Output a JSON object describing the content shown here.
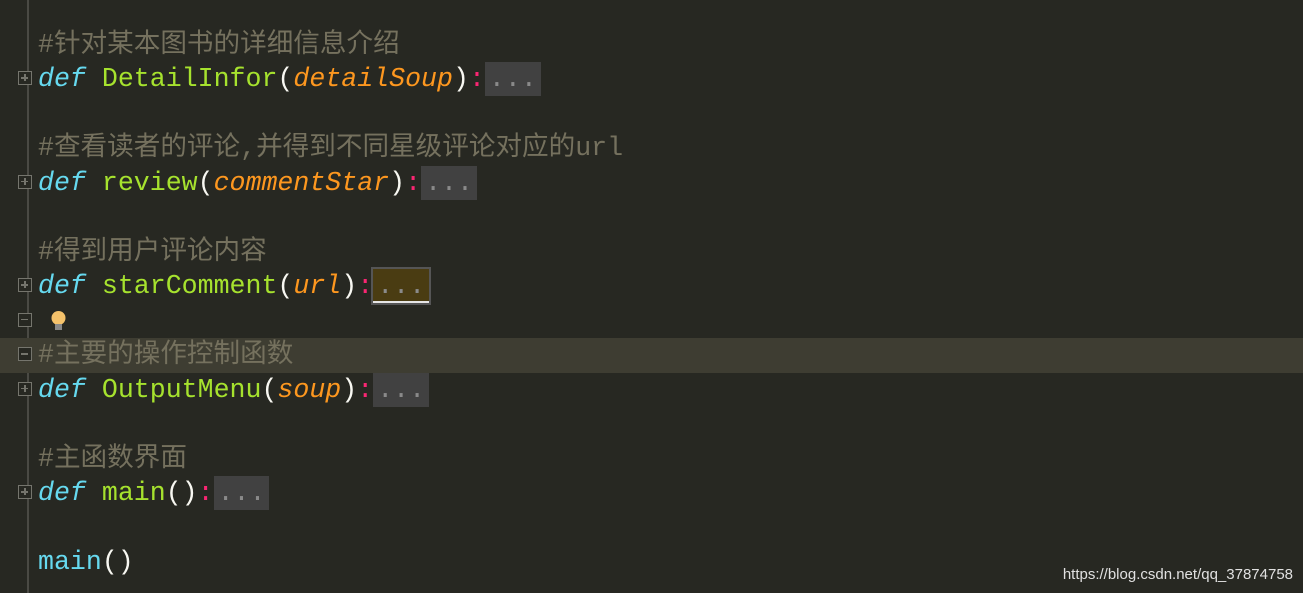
{
  "lines": [
    {
      "comment": "#针对某本图书的详细信息介绍"
    },
    {
      "kw": "def",
      "name": "DetailInfor",
      "param": "detailSoup",
      "fold": "..."
    },
    {
      "comment": "#查看读者的评论,并得到不同星级评论对应的url"
    },
    {
      "kw": "def",
      "name": "review",
      "param": "commentStar",
      "fold": "..."
    },
    {
      "comment": "#得到用户评论内容"
    },
    {
      "kw": "def",
      "name": "starComment",
      "param": "url",
      "fold": "..."
    },
    {
      "comment": "#主要的操作控制函数"
    },
    {
      "kw": "def",
      "name": "OutputMenu",
      "param": "soup",
      "fold": "..."
    },
    {
      "comment": "#主函数界面"
    },
    {
      "kw": "def",
      "name": "main",
      "param": "",
      "fold": "..."
    },
    {
      "call": "main"
    }
  ],
  "punct": {
    "open": "(",
    "close": ")",
    "colon": ":",
    "call_parens": "()"
  },
  "icons": {
    "fold": "plus-square-icon",
    "bulb": "lightbulb-icon"
  },
  "colors": {
    "background": "#272822",
    "keyword": "#66d9ef",
    "function": "#a6e22e",
    "param": "#fd971f",
    "comment": "#75715e",
    "colon": "#f92672"
  },
  "watermark": "https://blog.csdn.net/qq_37874758"
}
